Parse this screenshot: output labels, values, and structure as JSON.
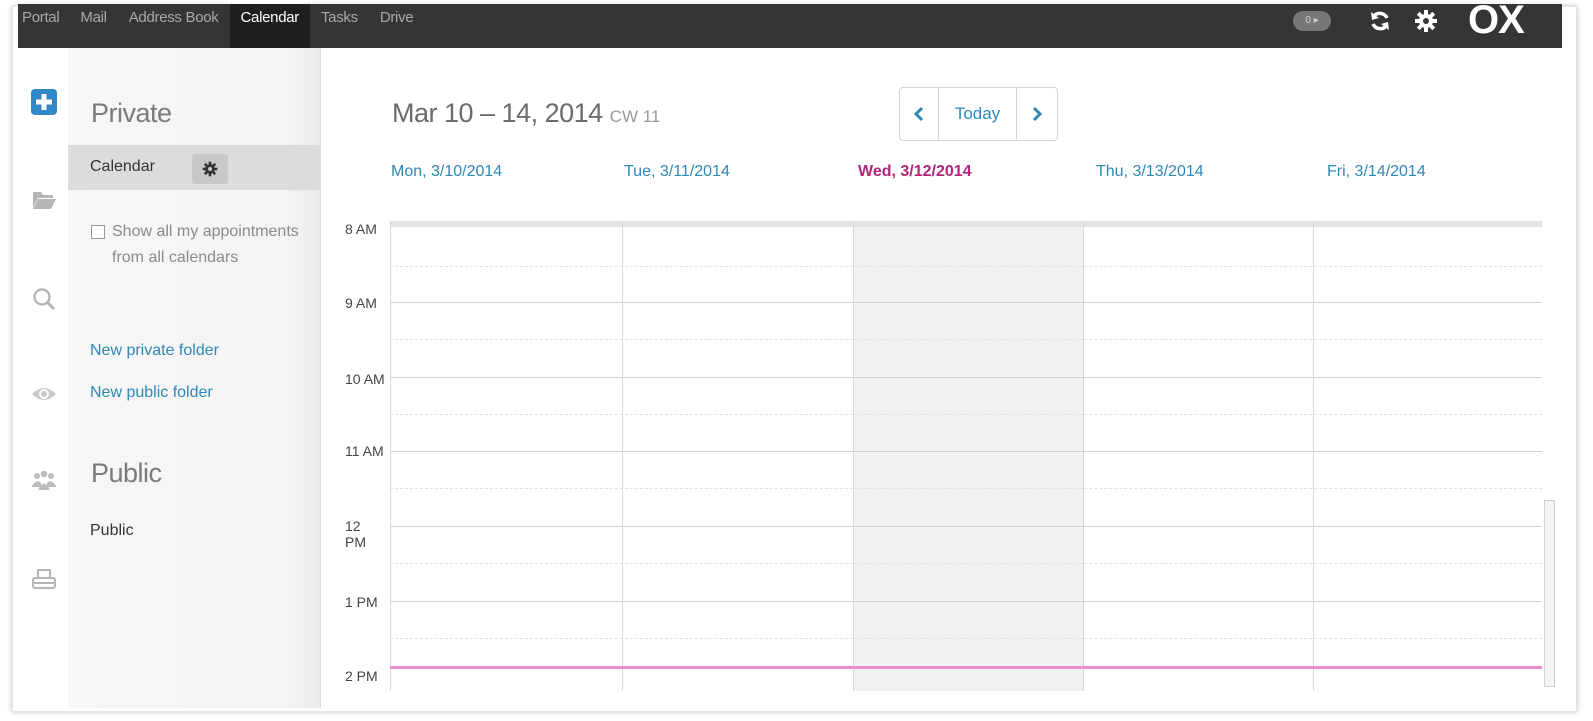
{
  "topbar": {
    "nav": [
      "Portal",
      "Mail",
      "Address Book",
      "Calendar",
      "Tasks",
      "Drive"
    ],
    "active": "Calendar",
    "badge": "0 ▸",
    "logo": "OX"
  },
  "rail": {
    "icons": [
      "new-appointment-icon",
      "folder-icon",
      "search-icon",
      "eye-icon",
      "people-icon",
      "print-icon"
    ],
    "accent": "#2f87c8"
  },
  "folders": {
    "private_title": "Private",
    "calendar_label": "Calendar",
    "show_all_label": "Show all my appointments from all calendars",
    "new_private_folder": "New private folder",
    "new_public_folder": "New public folder",
    "public_title": "Public",
    "public_item": "Public"
  },
  "header": {
    "range": "Mar 10 – 14, 2014",
    "cw": "CW 11",
    "today_label": "Today"
  },
  "days": [
    {
      "label": "Mon, 3/10/2014",
      "today": false
    },
    {
      "label": "Tue, 3/11/2014",
      "today": false
    },
    {
      "label": "Wed, 3/12/2014",
      "today": true
    },
    {
      "label": "Thu, 3/13/2014",
      "today": false
    },
    {
      "label": "Fri, 3/14/2014",
      "today": false
    }
  ],
  "times": [
    "8 AM",
    "9 AM",
    "10 AM",
    "11 AM",
    "12 PM",
    "1 PM",
    "2 PM"
  ],
  "colors": {
    "link": "#2f87b5",
    "today_header": "#b1267b",
    "now_line": "#f08ccd",
    "topbar": "#353535"
  }
}
